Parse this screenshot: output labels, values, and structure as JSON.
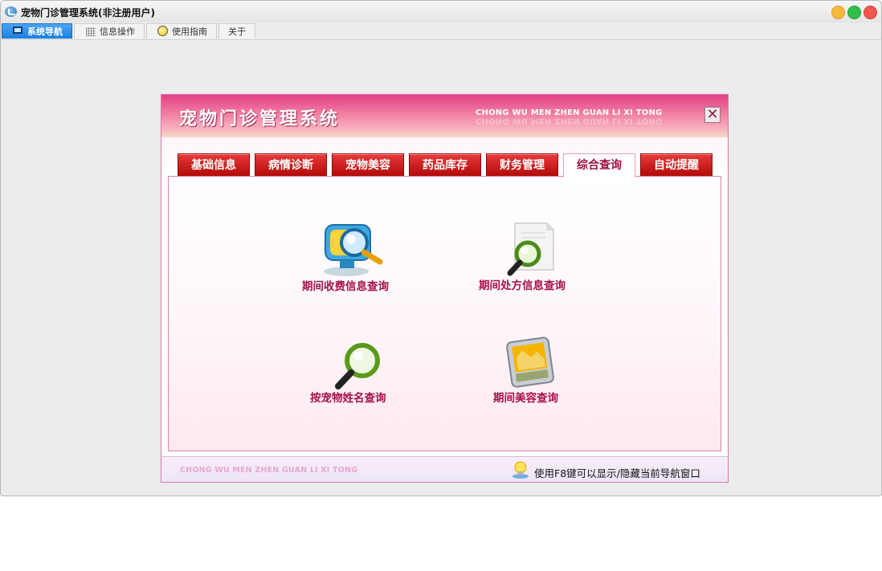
{
  "window": {
    "title": "宠物门诊管理系统(非注册用户)",
    "tabs": [
      {
        "label": "系统导航",
        "icon": "monitor-icon",
        "active": true
      },
      {
        "label": "信息操作",
        "icon": "grid-icon",
        "active": false
      },
      {
        "label": "使用指南",
        "icon": "bulb-icon",
        "active": false
      },
      {
        "label": "关于",
        "icon": "",
        "active": false
      }
    ]
  },
  "panel": {
    "title": "宠物门诊管理系统",
    "subtitle": "CHONG WU MEN ZHEN GUAN LI XI TONG",
    "close_label": "✕",
    "tabs": [
      {
        "label": "基础信息",
        "active": false
      },
      {
        "label": "病情诊断",
        "active": false
      },
      {
        "label": "宠物美容",
        "active": false
      },
      {
        "label": "药品库存",
        "active": false
      },
      {
        "label": "财务管理",
        "active": false
      },
      {
        "label": "综合查询",
        "active": true
      },
      {
        "label": "自动提醒",
        "active": false
      }
    ],
    "queries": [
      {
        "label": "期间收费信息查询",
        "icon": "monitor-search-icon"
      },
      {
        "label": "期间处方信息查询",
        "icon": "document-search-icon"
      },
      {
        "label": "按宠物姓名查询",
        "icon": "magnifier-icon"
      },
      {
        "label": "期间美容查询",
        "icon": "photo-frame-icon"
      }
    ],
    "footer": {
      "left": "CHONG WU MEN ZHEN  GUAN LI XI TONG",
      "hint": "使用F8键可以显示/隐藏当前导航窗口"
    }
  },
  "colors": {
    "accent_pink": "#e23f86",
    "tab_red": "#c81010",
    "label_crimson": "#a8104a"
  }
}
